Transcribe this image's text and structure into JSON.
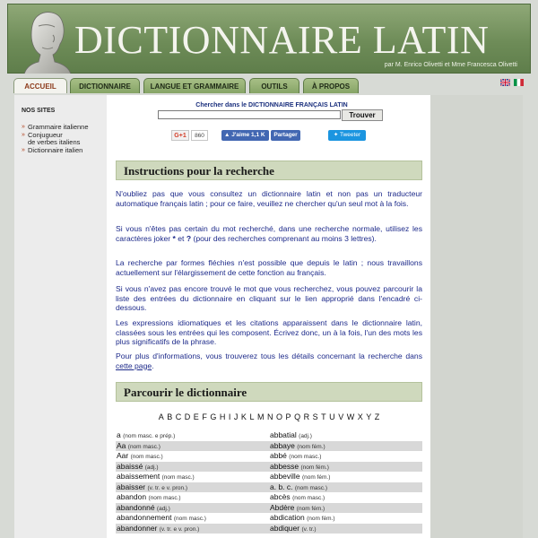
{
  "header": {
    "title": "DICTIONNAIRE LATIN",
    "authors": "par M. Enrico Olivetti et Mme Francesca Olivetti"
  },
  "tabs": [
    {
      "label": "ACCUEIL",
      "active": true
    },
    {
      "label": "DICTIONNAIRE",
      "active": false
    },
    {
      "label": "LANGUE ET GRAMMAIRE",
      "active": false
    },
    {
      "label": "OUTILS",
      "active": false
    },
    {
      "label": "À PROPOS",
      "active": false
    }
  ],
  "flags": [
    "uk-flag-icon",
    "italy-flag-icon"
  ],
  "sidebar": {
    "title": "NOS SITES",
    "items": [
      "Grammaire italienne",
      "Conjugueur",
      "de verbes italiens",
      "Dictionnaire italien"
    ]
  },
  "search": {
    "label": "Chercher dans le DICTIONNAIRE FRANÇAIS LATIN",
    "value": "",
    "button": "Trouver"
  },
  "social": {
    "gplus": "G+1",
    "gplus_count": "860",
    "fb_like": "J'aime 1,1 K",
    "fb_share": "Partager",
    "tweet": "Tweeter"
  },
  "instructions": {
    "heading": "Instructions pour la recherche",
    "p1": "N'oubliez pas que vous consultez un dictionnaire latin et non pas un traducteur automatique français latin ; pour ce faire, veuillez ne chercher qu'un seul mot à la fois.",
    "p2_a": "Si vous n'êtes pas certain du mot recherché, dans une recherche normale, utilisez les caractères joker ",
    "p2_star": "*",
    "p2_b": " et ",
    "p2_q": "?",
    "p2_c": " (pour des recherches comprenant au moins 3 lettres).",
    "p3": "La recherche par formes fléchies n'est possible que depuis le latin ; nous travaillons actuellement sur l'élargissement de cette fonction au français.",
    "p4": "Si vous n'avez pas encore trouvé le mot que vous recherchez, vous pouvez parcourir la liste des entrées du dictionnaire en cliquant sur le lien approprié dans l'encadré ci-dessous.",
    "p5": "Les expressions idiomatiques et les citations apparaissent dans le dictionnaire latin, classées sous les entrées qui les composent. Écrivez donc, un à la fois, l'un des mots les plus significatifs de la phrase.",
    "p6_a": "Pour plus d'informations, vous trouverez tous les détails concernant la recherche dans ",
    "p6_link": "cette page",
    "p6_b": "."
  },
  "browse": {
    "heading": "Parcourir le dictionnaire",
    "letters": [
      "A",
      "B",
      "C",
      "D",
      "E",
      "F",
      "G",
      "H",
      "I",
      "J",
      "K",
      "L",
      "M",
      "N",
      "O",
      "P",
      "Q",
      "R",
      "S",
      "T",
      "U",
      "V",
      "W",
      "X",
      "Y",
      "Z"
    ],
    "rows": [
      {
        "l_word": "a",
        "l_pos": "(nom masc. e prép.)",
        "r_word": "abbatial",
        "r_pos": "(adj.)"
      },
      {
        "l_word": "Aa",
        "l_pos": "(nom masc.)",
        "r_word": "abbaye",
        "r_pos": "(nom fém.)"
      },
      {
        "l_word": "Aar",
        "l_pos": "(nom masc.)",
        "r_word": "abbé",
        "r_pos": "(nom masc.)"
      },
      {
        "l_word": "abaissé",
        "l_pos": "(adj.)",
        "r_word": "abbesse",
        "r_pos": "(nom fém.)"
      },
      {
        "l_word": "abaissement",
        "l_pos": "(nom masc.)",
        "r_word": "abbeville",
        "r_pos": "(nom fém.)"
      },
      {
        "l_word": "abaisser",
        "l_pos": "(v. tr. e v. pron.)",
        "r_word": "a. b. c.",
        "r_pos": "(nom masc.)"
      },
      {
        "l_word": "abandon",
        "l_pos": "(nom masc.)",
        "r_word": "abcès",
        "r_pos": "(nom masc.)"
      },
      {
        "l_word": "abandonné",
        "l_pos": "(adj.)",
        "r_word": "Abdère",
        "r_pos": "(nom fém.)"
      },
      {
        "l_word": "abandonnement",
        "l_pos": "(nom masc.)",
        "r_word": "abdication",
        "r_pos": "(nom fém.)"
      },
      {
        "l_word": "abandonner",
        "l_pos": "(v. tr. e v. pron.)",
        "r_word": "abdiquer",
        "r_pos": "(v. tr.)"
      }
    ]
  }
}
